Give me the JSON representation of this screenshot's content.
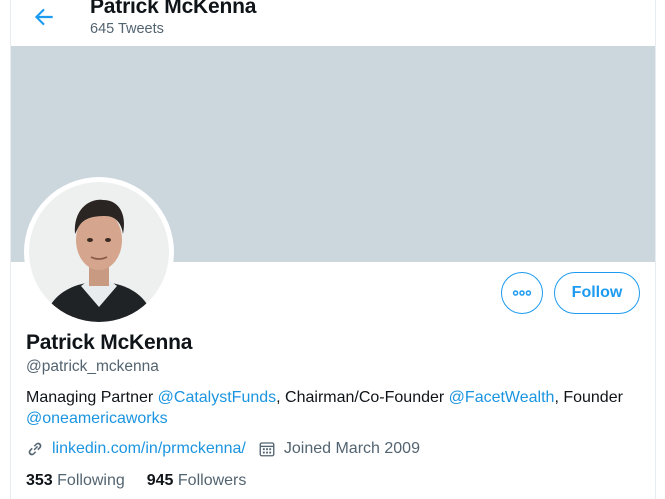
{
  "header": {
    "name": "Patrick McKenna",
    "tweet_count": "645 Tweets"
  },
  "profile": {
    "name": "Patrick McKenna",
    "handle": "@patrick_mckenna",
    "bio": {
      "prefix": "Managing Partner ",
      "mention1": "@CatalystFunds",
      "middle": ", Chairman/Co-Founder ",
      "mention2": "@FacetWealth",
      "suffix": ", Founder ",
      "mention3": "@oneamericaworks"
    },
    "website": "linkedin.com/in/prmckenna/",
    "joined": "Joined March 2009"
  },
  "stats": {
    "following_count": "353",
    "following_label": "Following",
    "followers_count": "945",
    "followers_label": "Followers"
  },
  "actions": {
    "follow_label": "Follow",
    "more_icon": "more-horizontal-icon"
  },
  "colors": {
    "accent": "#1d9bf0",
    "banner": "#ccd6dd",
    "secondary_text": "#536471"
  }
}
